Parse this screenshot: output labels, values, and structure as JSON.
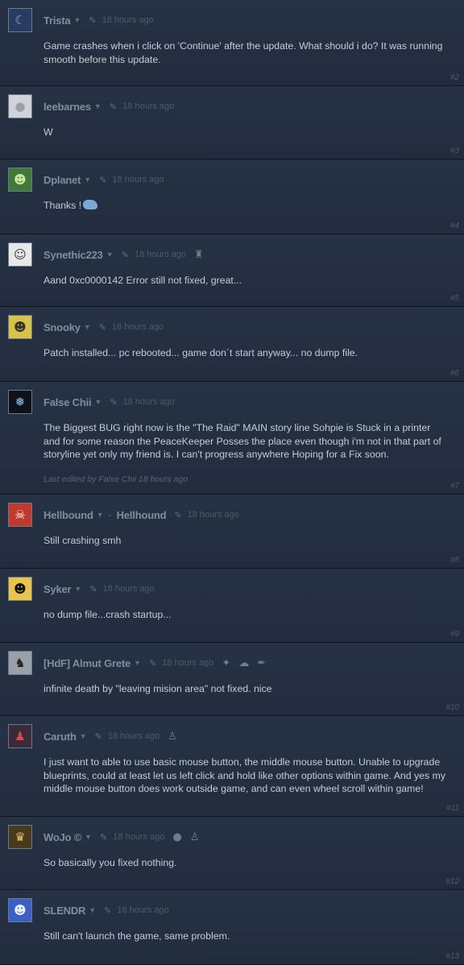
{
  "comments": [
    {
      "author": "Trista",
      "time": "18 hours ago",
      "number": "#2",
      "text": "Game crashes when i click on 'Continue' after the update. What should i do? It was running smooth before this update."
    },
    {
      "author": "leebarnes",
      "time": "18 hours ago",
      "number": "#3",
      "text": "W"
    },
    {
      "author": "Dplanet",
      "time": "18 hours ago",
      "number": "#4",
      "text": "Thanks !"
    },
    {
      "author": "Synethic223",
      "time": "18 hours ago",
      "number": "#5",
      "text": "Aand 0xc0000142 Error still not fixed, great..."
    },
    {
      "author": "Snooky",
      "time": "18 hours ago",
      "number": "#6",
      "text": "Patch installed... pc rebooted... game don´t start anyway... no dump file."
    },
    {
      "author": "False Chii",
      "time": "18 hours ago",
      "number": "#7",
      "text": "The Biggest BUG right now is the \"The Raid\" MAIN story line Sohpie is Stuck in a printer and for some reason the PeaceKeeper Posses the place even though i'm not in that part of storyline yet only my friend is. I can't progress anywhere Hoping for a Fix soon.",
      "edited_prefix": "Last edited by",
      "edited_author": "False Chii",
      "edited_time": "18 hours ago"
    },
    {
      "author": "Hellbound",
      "alias": "Hellhound",
      "time": "18 hours ago",
      "number": "#8",
      "text": "Still crashing smh"
    },
    {
      "author": "Syker",
      "time": "18 hours ago",
      "number": "#9",
      "text": "no dump file...crash startup..."
    },
    {
      "author": "[HdF] Almut Grete",
      "time": "18 hours ago",
      "number": "#10",
      "text": "infinite death by \"leaving mision area\" not fixed. nice"
    },
    {
      "author": "Caruth",
      "time": "18 hours ago",
      "number": "#11",
      "text": "I just want to able to use basic mouse button, the middle mouse button. Unable to upgrade blueprints, could at least let us left click and hold like other options within game. And yes my middle mouse button does work outside game, and can even wheel scroll within game!"
    },
    {
      "author": "WoJo ©",
      "time": "18 hours ago",
      "number": "#12",
      "text": "So basically you fixed nothing."
    },
    {
      "author": "SLENDR",
      "time": "18 hours ago",
      "number": "#13",
      "text": "Still can't launch the game, same problem."
    }
  ],
  "icons": {
    "tag": "tag-icon",
    "caret": "chevron-down-icon"
  },
  "colors": {
    "background": "#1b2333",
    "author": "#7d8ea3",
    "text": "#c5ccd5",
    "meta": "#4c5a6d"
  }
}
